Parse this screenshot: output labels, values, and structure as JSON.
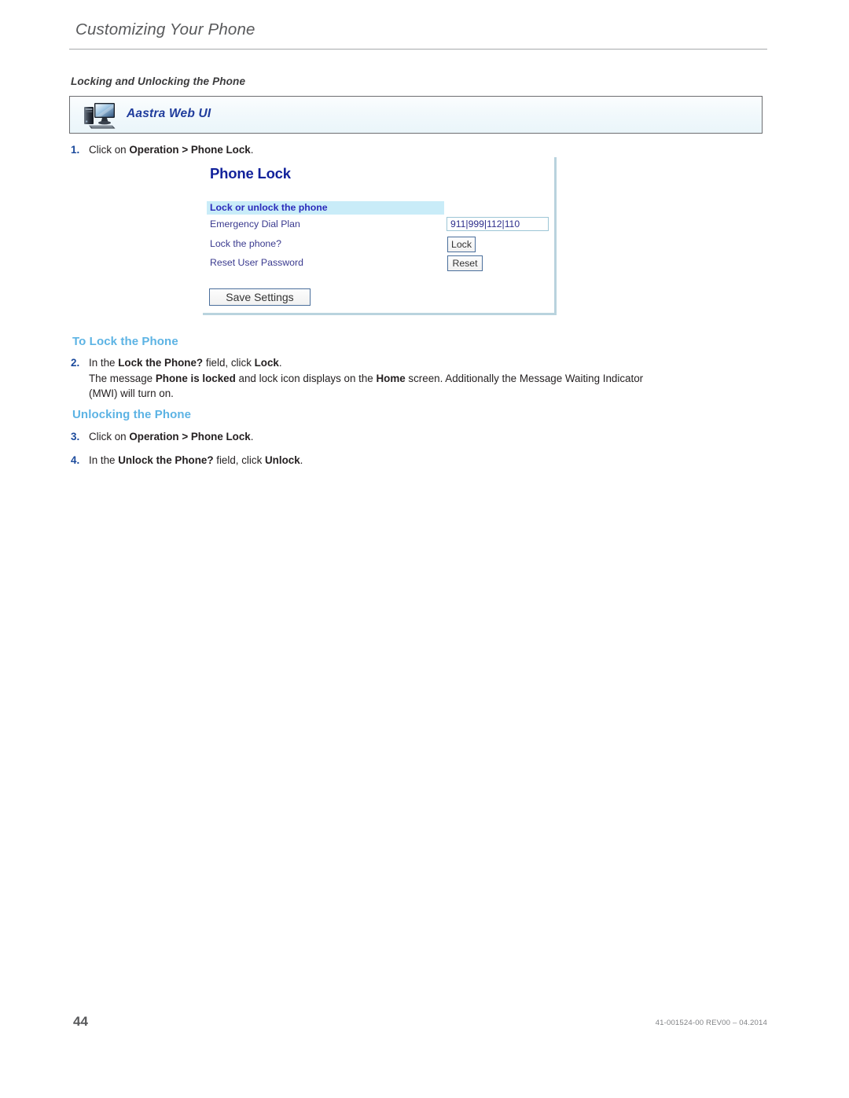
{
  "header": {
    "running_head": "Customizing Your Phone",
    "section_heading": "Locking and Unlocking the Phone"
  },
  "webui_banner": {
    "icon": "desktop-computer-icon",
    "label": "Aastra Web UI"
  },
  "steps": {
    "step1": {
      "number": "1.",
      "text_parts": [
        "Click on ",
        "Operation > Phone Lock",
        "."
      ]
    },
    "step2": {
      "number": "2.",
      "line1_parts": [
        "In the ",
        "Lock the Phone?",
        " field, click ",
        "Lock",
        "."
      ],
      "line2_parts": [
        "The message ",
        "Phone is locked",
        " and lock icon displays on the ",
        "Home",
        " screen. Additionally the Message Waiting Indicator (MWI) will turn on."
      ]
    },
    "step3": {
      "number": "3.",
      "text_parts": [
        "Click on ",
        "Operation > Phone Lock",
        "."
      ]
    },
    "step4": {
      "number": "4.",
      "text_parts": [
        "In the ",
        "Unlock the Phone?",
        " field, click ",
        "Unlock",
        "."
      ]
    }
  },
  "subheadings": {
    "to_lock": "To Lock the Phone",
    "unlocking": "Unlocking the Phone"
  },
  "screenshot": {
    "title": "Phone Lock",
    "section_bar": "Lock or unlock the phone",
    "rows": [
      {
        "label": "Emergency Dial Plan",
        "control": "input",
        "value": "911|999|112|110"
      },
      {
        "label": "Lock the phone?",
        "control": "button",
        "value": "Lock"
      },
      {
        "label": "Reset User Password",
        "control": "button",
        "value": "Reset"
      }
    ],
    "save_button": "Save Settings"
  },
  "footer": {
    "page_number": "44",
    "doc_ref": "41-001524-00 REV00 – 04.2014"
  },
  "colors": {
    "accent_blue": "#5cb3e4",
    "step_number_blue": "#1b4a9c",
    "banner_label_blue": "#1f3c9c",
    "shot_title_blue": "#12229b",
    "section_bar_cyan": "#c9ecf8"
  }
}
